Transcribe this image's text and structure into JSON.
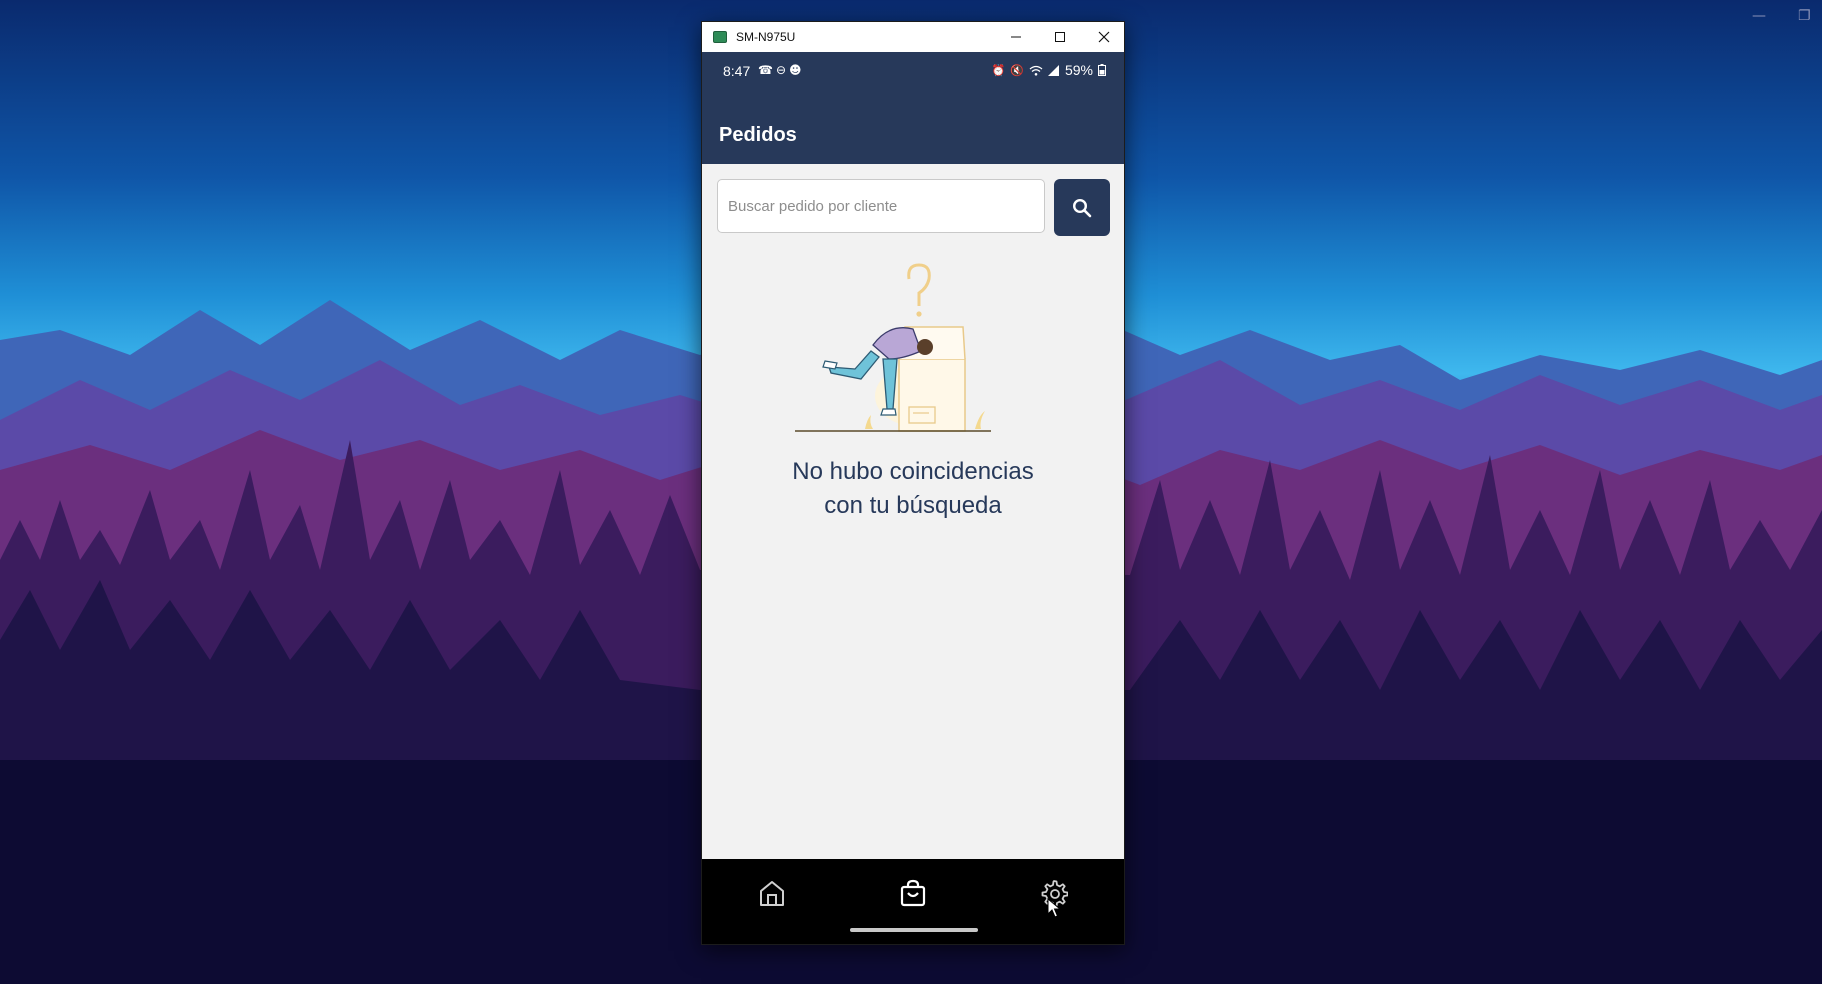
{
  "window": {
    "title": "SM-N975U",
    "minimize_icon": "minimize-icon",
    "maximize_icon": "maximize-icon",
    "close_icon": "close-icon"
  },
  "status_bar": {
    "time": "8:47",
    "left_icons": [
      "whatsapp-icon",
      "dnd-icon",
      "notification-icon"
    ],
    "right_icons": [
      "alarm-icon",
      "mute-icon",
      "wifi-icon",
      "signal-icon"
    ],
    "battery": "59%"
  },
  "header": {
    "title": "Pedidos"
  },
  "search": {
    "placeholder": "Buscar pedido por cliente",
    "value": "",
    "button_icon": "search-icon"
  },
  "empty_state": {
    "line1": "No hubo coincidencias",
    "line2": "con tu búsqueda"
  },
  "bottom_nav": {
    "items": [
      {
        "icon": "home-icon"
      },
      {
        "icon": "shopping-bag-icon",
        "active": true
      },
      {
        "icon": "gear-icon"
      }
    ]
  },
  "colors": {
    "primary": "#27395a",
    "background": "#f2f2f2",
    "nav_background": "#000000"
  }
}
